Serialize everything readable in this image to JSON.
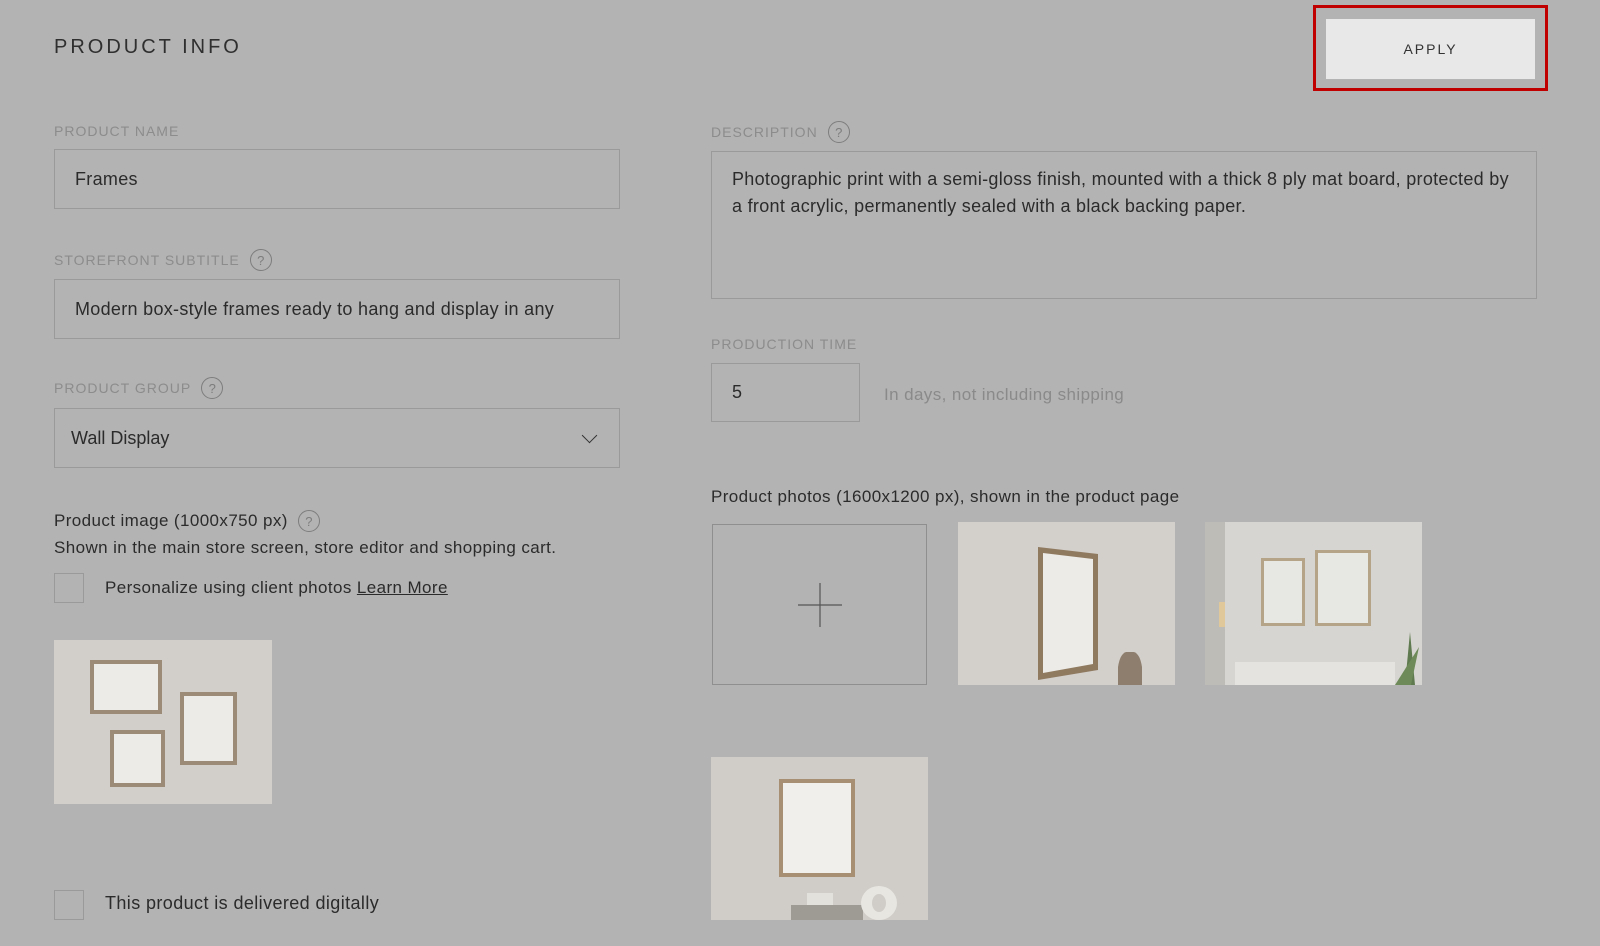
{
  "header": {
    "title": "PRODUCT INFO",
    "apply_label": "APPLY"
  },
  "product_name": {
    "label": "PRODUCT NAME",
    "value": "Frames"
  },
  "storefront_subtitle": {
    "label": "STOREFRONT SUBTITLE",
    "value": "Modern box-style frames ready to hang and display in any"
  },
  "product_group": {
    "label": "PRODUCT GROUP",
    "selected": "Wall Display"
  },
  "product_image": {
    "title": "Product image (1000x750 px)",
    "subtitle": "Shown in the main store screen, store editor and shopping cart."
  },
  "personalize": {
    "label": "Personalize using client photos",
    "link": "Learn More"
  },
  "digital": {
    "label": "This product is delivered digitally"
  },
  "description": {
    "label": "DESCRIPTION",
    "value": "Photographic print with a semi-gloss finish, mounted with a thick 8 ply mat board, protected by a front acrylic, permanently sealed with a black backing paper."
  },
  "production_time": {
    "label": "PRODUCTION TIME",
    "value": "5",
    "hint": "In days, not including shipping"
  },
  "product_photos": {
    "label": "Product photos (1600x1200 px), shown in the product page"
  },
  "icons": {
    "help": "?"
  }
}
